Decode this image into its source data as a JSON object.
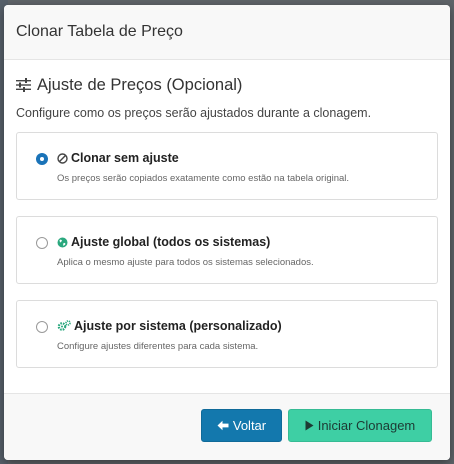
{
  "modal": {
    "title": "Clonar Tabela de Preço"
  },
  "section": {
    "icon": "sliders-icon",
    "title": "Ajuste de Preços (Opcional)",
    "description": "Configure como os preços serão ajustados durante a clonagem."
  },
  "options": [
    {
      "title": "Clonar sem ajuste",
      "subtitle": "Os preços serão copiados exatamente como estão na tabela original.",
      "icon": "ban-icon",
      "selected": true
    },
    {
      "title": "Ajuste global (todos os sistemas)",
      "subtitle": "Aplica o mesmo ajuste para todos os sistemas selecionados.",
      "icon": "globe-icon",
      "selected": false
    },
    {
      "title": "Ajuste por sistema (personalizado)",
      "subtitle": "Configure ajustes diferentes para cada sistema.",
      "icon": "cogs-icon",
      "selected": false
    }
  ],
  "footer": {
    "back_label": "Voltar",
    "start_label": "Iniciar Clonagem"
  },
  "colors": {
    "primary": "#1378ad",
    "success": "#3ecfa4",
    "radio_selected": "#1a73b8",
    "icon_accent": "#2aa87e"
  }
}
